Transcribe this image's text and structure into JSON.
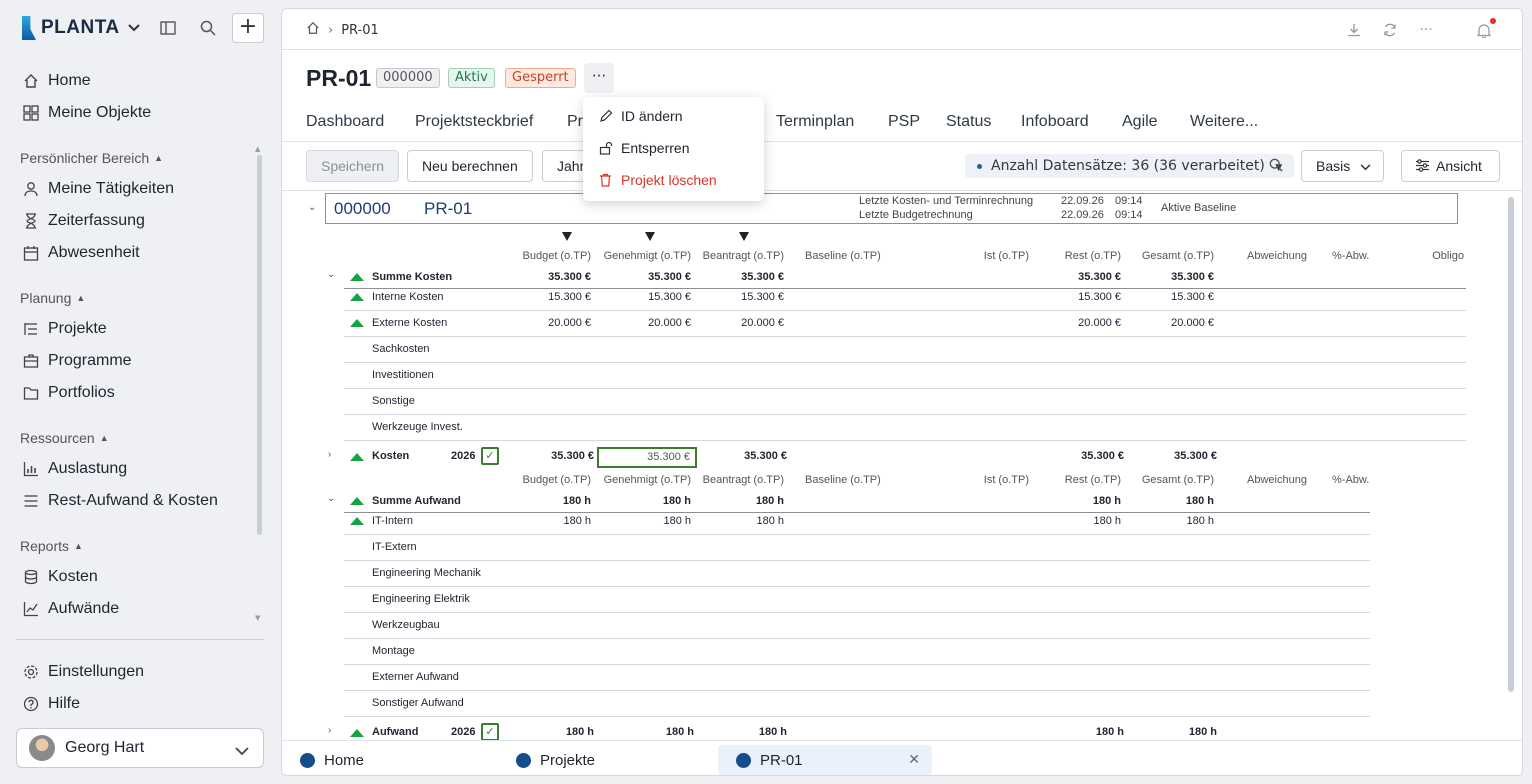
{
  "brand": {
    "name": "PLANTA"
  },
  "sidebar": {
    "top_items": [
      {
        "label": "Home"
      },
      {
        "label": "Meine Objekte"
      }
    ],
    "sections": [
      {
        "title": "Persönlicher Bereich",
        "items": [
          {
            "label": "Meine Tätigkeiten"
          },
          {
            "label": "Zeiterfassung"
          },
          {
            "label": "Abwesenheit"
          }
        ]
      },
      {
        "title": "Planung",
        "items": [
          {
            "label": "Projekte"
          },
          {
            "label": "Programme"
          },
          {
            "label": "Portfolios"
          }
        ]
      },
      {
        "title": "Ressourcen",
        "items": [
          {
            "label": "Auslastung"
          },
          {
            "label": "Rest-Aufwand & Kosten"
          }
        ]
      },
      {
        "title": "Reports",
        "items": [
          {
            "label": "Kosten"
          },
          {
            "label": "Aufwände"
          }
        ]
      }
    ],
    "bottom_items": [
      {
        "label": "Einstellungen"
      },
      {
        "label": "Hilfe"
      }
    ],
    "user": {
      "name": "Georg Hart"
    }
  },
  "breadcrumb": {
    "current": "PR-01"
  },
  "project": {
    "title": "PR-01",
    "id_badge": "000000",
    "status_active": "Aktiv",
    "status_locked": "Gesperrt",
    "more_label": "···"
  },
  "tabs": [
    {
      "label": "Dashboard"
    },
    {
      "label": "Projektsteckbrief"
    },
    {
      "label": "Pr"
    },
    {
      "label": "Terminplan"
    },
    {
      "label": "PSP"
    },
    {
      "label": "Status"
    },
    {
      "label": "Infoboard"
    },
    {
      "label": "Agile"
    },
    {
      "label": "Weitere..."
    }
  ],
  "toolbar": {
    "save": "Speichern",
    "recalc": "Neu berechnen",
    "year": "Jahr",
    "records": "Anzahl Datensätze: 36 (36 verarbeitet)",
    "basis": "Basis",
    "view": "Ansicht"
  },
  "dropdown": {
    "items": [
      {
        "label": "ID ändern"
      },
      {
        "label": "Entsperren"
      },
      {
        "label": "Projekt löschen"
      }
    ]
  },
  "grid": {
    "project_id": "000000",
    "project_name": "PR-01",
    "last_calc_label": "Letzte Kosten- und Terminrechnung",
    "last_calc_date": "22.09.26",
    "last_calc_time": "09:14",
    "last_budget_label": "Letzte Budgetrechnung",
    "last_budget_date": "22.09.26",
    "last_budget_time": "09:14",
    "baseline_label": "Aktive Baseline",
    "columns": [
      "Budget (o.TP)",
      "Genehmigt (o.TP)",
      "Beantragt (o.TP)",
      "Baseline (o.TP)",
      "Ist (o.TP)",
      "Rest (o.TP)",
      "Gesamt (o.TP)",
      "Abweichung",
      "%-Abw.",
      "Obligo"
    ],
    "cost": {
      "sum_label": "Summe Kosten",
      "sum": [
        "35.300 €",
        "35.300 €",
        "35.300 €",
        "35.300 €",
        "35.300 €"
      ],
      "rows": [
        {
          "label": "Interne Kosten",
          "vals": [
            "15.300 €",
            "15.300 €",
            "15.300 €",
            "15.300 €",
            "15.300 €"
          ]
        },
        {
          "label": "Externe Kosten",
          "vals": [
            "20.000 €",
            "20.000 €",
            "20.000 €",
            "20.000 €",
            "20.000 €"
          ]
        },
        {
          "label": "Sachkosten"
        },
        {
          "label": "Investitionen"
        },
        {
          "label": "Sonstige"
        },
        {
          "label": "Werkzeuge Invest."
        }
      ],
      "year_label": "Kosten",
      "year": "2026",
      "year_check": "✓",
      "year_vals": [
        "35.300 €",
        "35.300 €",
        "35.300 €",
        "35.300 €",
        "35.300 €"
      ]
    },
    "effort": {
      "sum_label": "Summe Aufwand",
      "sum": [
        "180 h",
        "180 h",
        "180 h",
        "180 h",
        "180 h"
      ],
      "rows": [
        {
          "label": "IT-Intern",
          "vals": [
            "180 h",
            "180 h",
            "180 h",
            "180 h",
            "180 h"
          ]
        },
        {
          "label": "IT-Extern"
        },
        {
          "label": "Engineering Mechanik"
        },
        {
          "label": "Engineering Elektrik"
        },
        {
          "label": "Werkzeugbau"
        },
        {
          "label": "Montage"
        },
        {
          "label": "Externer Aufwand"
        },
        {
          "label": "Sonstiger Aufwand"
        }
      ],
      "year_label": "Aufwand",
      "year": "2026",
      "year_check": "✓",
      "year_vals": [
        "180 h",
        "180 h",
        "180 h",
        "180 h",
        "180 h"
      ]
    }
  },
  "bottom_tabs": [
    {
      "label": "Home"
    },
    {
      "label": "Projekte"
    },
    {
      "label": "PR-01"
    }
  ],
  "colors": {
    "accent": "#144d8c",
    "green": "#13a544",
    "danger": "#d63426"
  }
}
